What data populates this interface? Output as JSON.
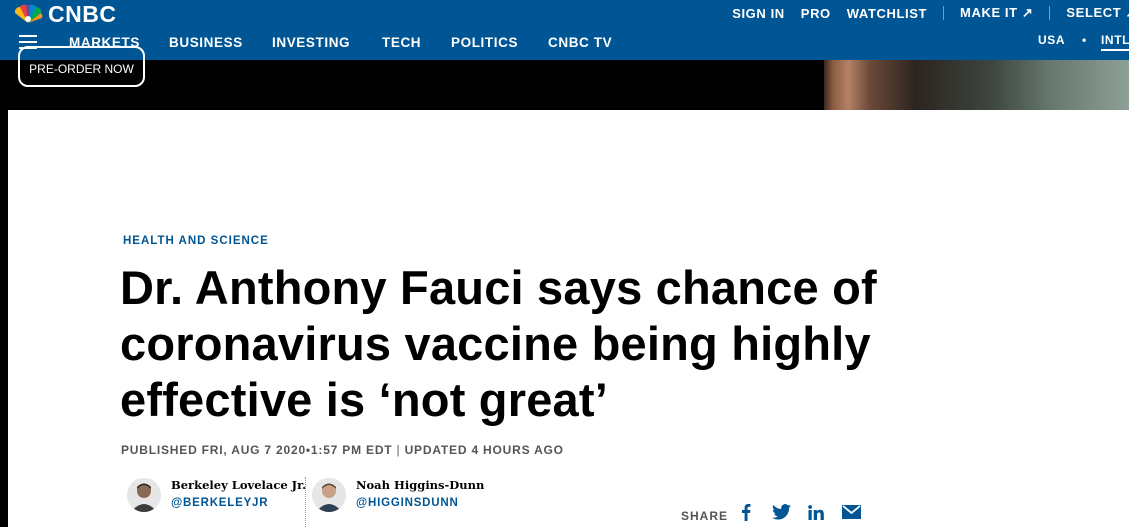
{
  "brand": {
    "name": "CNBC"
  },
  "top_links": [
    {
      "label": "SIGN IN"
    },
    {
      "label": "PRO"
    },
    {
      "label": "WATCHLIST"
    },
    {
      "label": "MAKE IT ↗"
    },
    {
      "label": "SELECT ↗"
    }
  ],
  "main_nav": [
    "MARKETS",
    "BUSINESS",
    "INVESTING",
    "TECH",
    "POLITICS",
    "CNBC TV"
  ],
  "region": {
    "usa": "USA",
    "separator": "•",
    "intl": "INTL"
  },
  "ad": {
    "button_label": "PRE-ORDER NOW"
  },
  "article": {
    "kicker": "HEALTH AND SCIENCE",
    "headline": "Dr. Anthony Fauci says chance of coronavirus vaccine being highly effective is ‘not great’",
    "published": "PUBLISHED FRI, AUG 7 2020•1:57 PM EDT",
    "updated": "UPDATED 4 HOURS AGO",
    "authors": [
      {
        "name": "Berkeley Lovelace Jr.",
        "handle": "@BERKELEYJR"
      },
      {
        "name": "Noah Higgins-Dunn",
        "handle": "@HIGGINSDUNN"
      }
    ],
    "share_label": "SHARE",
    "share_icons": [
      "facebook-icon",
      "twitter-icon",
      "linkedin-icon",
      "email-icon"
    ]
  },
  "colors": {
    "brand_blue": "#005594",
    "text": "#000000",
    "meta": "#555555"
  }
}
